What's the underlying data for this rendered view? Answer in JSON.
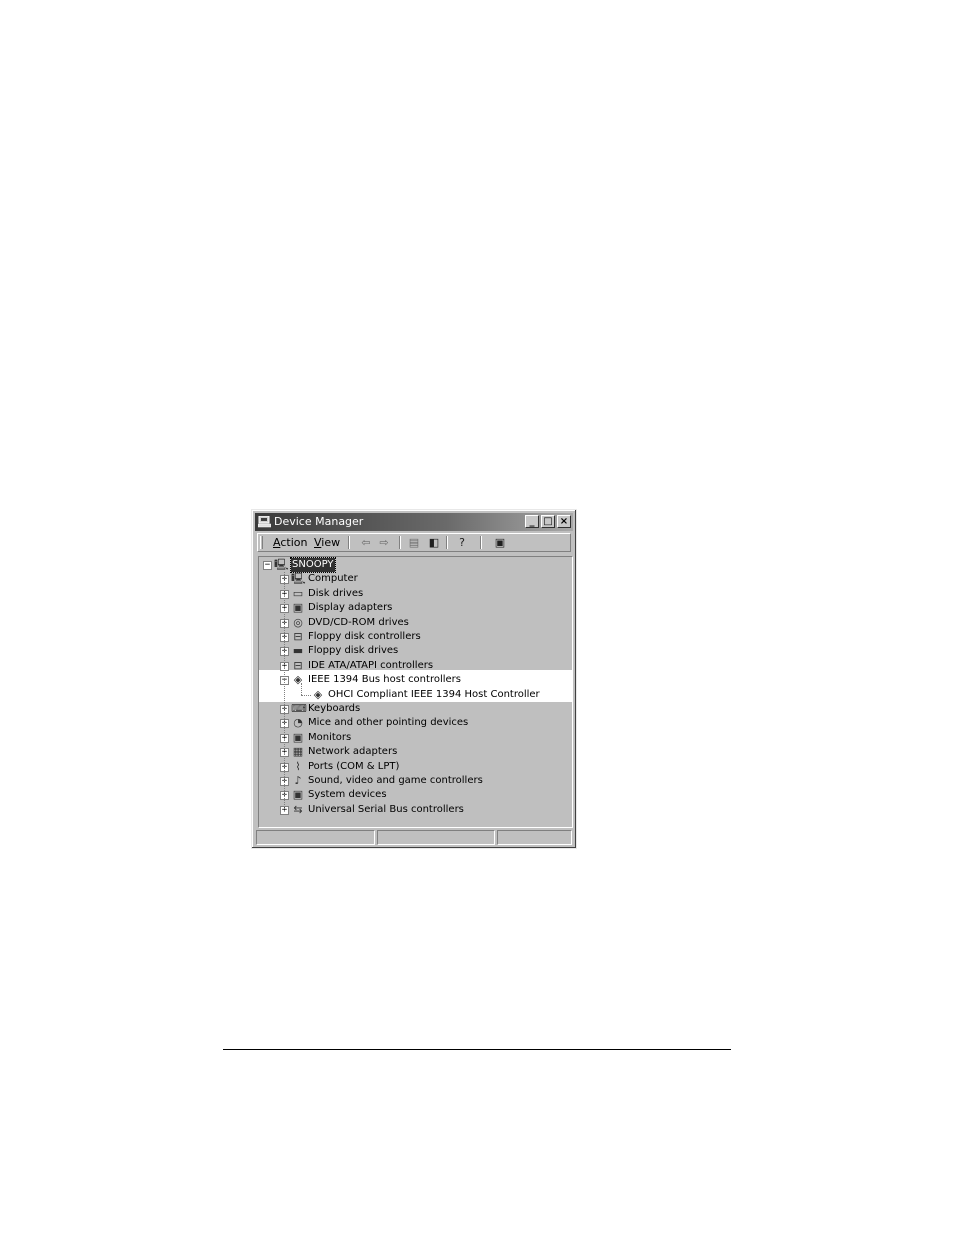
{
  "window": {
    "title": "Device Manager",
    "controls": {
      "minimize": "_",
      "maximize": "□",
      "close": "×"
    }
  },
  "menu": {
    "action": {
      "mnemonic": "A",
      "rest": "ction"
    },
    "view": {
      "mnemonic": "V",
      "rest": "iew"
    }
  },
  "toolbar": {
    "back": "⇦",
    "forward": "⇨",
    "tool_a": "▤",
    "tool_b": "◧",
    "properties": "?",
    "scan": "▣"
  },
  "tree": {
    "root": {
      "label": "SNOOPY",
      "expander": "−",
      "icon": "computer-icon"
    },
    "items": [
      {
        "label": "Computer",
        "expander": "+",
        "icon": "computer-icon"
      },
      {
        "label": "Disk drives",
        "expander": "+",
        "icon": "disk-drive-icon"
      },
      {
        "label": "Display adapters",
        "expander": "+",
        "icon": "display-adapter-icon"
      },
      {
        "label": "DVD/CD-ROM drives",
        "expander": "+",
        "icon": "cd-rom-icon"
      },
      {
        "label": "Floppy disk controllers",
        "expander": "+",
        "icon": "floppy-controller-icon"
      },
      {
        "label": "Floppy disk drives",
        "expander": "+",
        "icon": "floppy-drive-icon"
      },
      {
        "label": "IDE ATA/ATAPI controllers",
        "expander": "+",
        "icon": "ide-controller-icon"
      },
      {
        "label": "IEEE 1394 Bus host controllers",
        "expander": "−",
        "icon": "ieee1394-icon",
        "children": [
          {
            "label": "OHCI Compliant IEEE 1394 Host Controller",
            "icon": "ieee1394-icon"
          }
        ]
      },
      {
        "label": "Keyboards",
        "expander": "+",
        "icon": "keyboard-icon"
      },
      {
        "label": "Mice and other pointing devices",
        "expander": "+",
        "icon": "mouse-icon"
      },
      {
        "label": "Monitors",
        "expander": "+",
        "icon": "monitor-icon"
      },
      {
        "label": "Network adapters",
        "expander": "+",
        "icon": "network-adapter-icon"
      },
      {
        "label": "Ports (COM & LPT)",
        "expander": "+",
        "icon": "port-icon"
      },
      {
        "label": "Sound, video and game controllers",
        "expander": "+",
        "icon": "sound-icon"
      },
      {
        "label": "System devices",
        "expander": "+",
        "icon": "system-devices-icon"
      },
      {
        "label": "Universal Serial Bus controllers",
        "expander": "+",
        "icon": "usb-icon"
      }
    ]
  },
  "glyphs": {
    "computer-icon": "🖳",
    "disk-drive-icon": "▭",
    "display-adapter-icon": "▣",
    "cd-rom-icon": "◎",
    "floppy-controller-icon": "⊟",
    "floppy-drive-icon": "▬",
    "ide-controller-icon": "⊟",
    "ieee1394-icon": "◈",
    "keyboard-icon": "⌨",
    "mouse-icon": "◔",
    "monitor-icon": "▣",
    "network-adapter-icon": "▦",
    "port-icon": "⌇",
    "sound-icon": "♪",
    "system-devices-icon": "▣",
    "usb-icon": "⇆"
  },
  "colors": {
    "titlebar": "#3a3a3a",
    "highlight_band": "#ffffff",
    "window_face": "#c0c0c0"
  }
}
